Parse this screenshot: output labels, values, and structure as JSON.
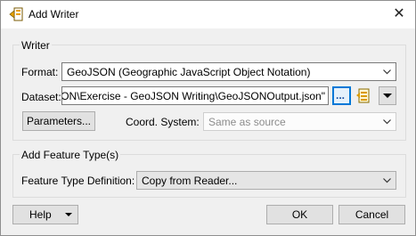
{
  "window": {
    "title": "Add Writer",
    "close_glyph": "✕"
  },
  "writer_group": {
    "title": "Writer",
    "format": {
      "label": "Format:",
      "value": "GeoJSON (Geographic JavaScript Object Notation)"
    },
    "dataset": {
      "label": "Dataset:",
      "value": "ON\\Exercise - GeoJSON Writing\\GeoJSONOutput.json\"",
      "browse_label": "..."
    },
    "parameters_button": "Parameters...",
    "coord_system": {
      "label": "Coord. System:",
      "value": "Same as source"
    }
  },
  "feature_group": {
    "title": "Add Feature Type(s)",
    "definition": {
      "label": "Feature Type Definition:",
      "value": "Copy from Reader..."
    }
  },
  "buttons": {
    "help": "Help",
    "ok": "OK",
    "cancel": "Cancel"
  },
  "colors": {
    "accent": "#0078d7",
    "browse_dots": "#1a4fa0"
  }
}
